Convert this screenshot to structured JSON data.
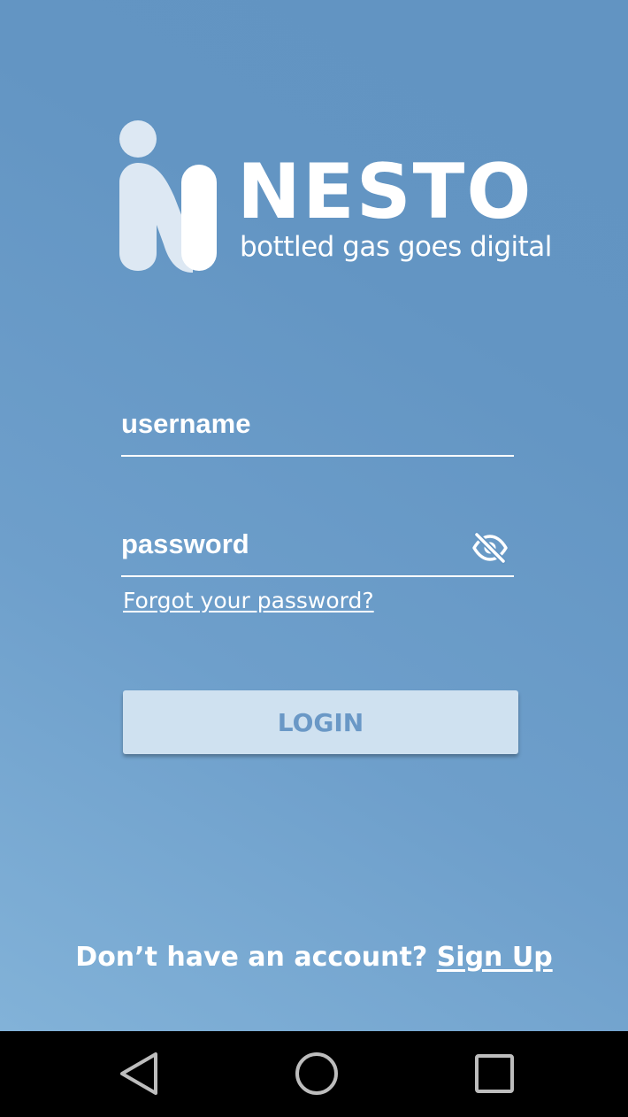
{
  "brand": {
    "name": "NESTO",
    "tagline": "bottled gas goes digital",
    "logo_icon": "nesto-logo-icon"
  },
  "form": {
    "username_placeholder": "username",
    "username_value": "",
    "password_placeholder": "password",
    "password_value": "",
    "password_toggle_icon": "eye-off-icon",
    "forgot_link": "Forgot your password?",
    "login_label": "LOGIN"
  },
  "footer": {
    "prompt": "Don’t have an account?",
    "signup_link": "Sign Up"
  },
  "navbar": {
    "back_icon": "back-triangle-icon",
    "home_icon": "home-circle-icon",
    "recent_icon": "recent-apps-square-icon"
  },
  "colors": {
    "background_start": "#82b2d8",
    "background_end": "#6294c2",
    "logo_mark": "#dde8f3",
    "text": "#ffffff",
    "button_bg": "#cfe1f0",
    "button_text": "#6a98c6",
    "navbar": "#000000"
  }
}
